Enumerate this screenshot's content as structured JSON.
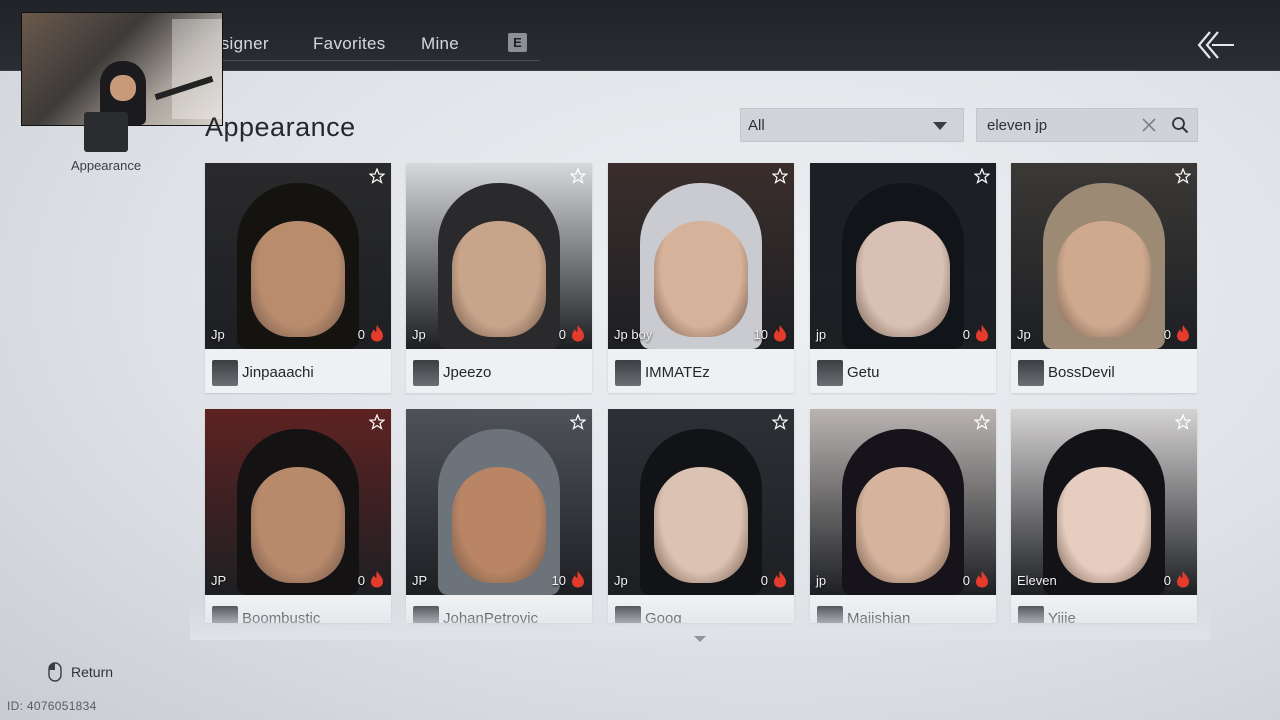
{
  "nav": {
    "tabs": [
      "esigner",
      "Favorites",
      "Mine"
    ],
    "hotkey": "E"
  },
  "sidebar": {
    "label": "Appearance"
  },
  "page": {
    "title": "Appearance"
  },
  "filter": {
    "selected": "All"
  },
  "search": {
    "value": "eleven jp"
  },
  "cards": [
    {
      "tag": "Jp",
      "likes": "0",
      "name": "Jinpaaachi",
      "hair": "#15130f",
      "skin": "#b98c6e",
      "bg": "#2a2a2c"
    },
    {
      "tag": "Jp",
      "likes": "0",
      "name": "Jpeezo",
      "hair": "#2a2a2d",
      "skin": "#c8a48a",
      "bg": "#d7d9dc"
    },
    {
      "tag": "Jp boy",
      "likes": "10",
      "name": "IMMATEz",
      "hair": "#c9cbd0",
      "skin": "#d7b29a",
      "bg": "#3b2e2c"
    },
    {
      "tag": "jp",
      "likes": "0",
      "name": "Getu",
      "hair": "#111418",
      "skin": "#d8c1b4",
      "bg": "#1c2026"
    },
    {
      "tag": "Jp",
      "likes": "0",
      "name": "BossDevil",
      "hair": "#9c8a74",
      "skin": "#cfa98e",
      "bg": "#3b3936"
    },
    {
      "tag": "JP",
      "likes": "0",
      "name": "Boombustic",
      "hair": "#141213",
      "skin": "#b88a6c",
      "bg": "#5e2222"
    },
    {
      "tag": "JP",
      "likes": "10",
      "name": "JohanPetrovic",
      "hair": "#6d737a",
      "skin": "#b98565",
      "bg": "#4f5359"
    },
    {
      "tag": "Jp",
      "likes": "0",
      "name": "Goog",
      "hair": "#121316",
      "skin": "#dcc2b2",
      "bg": "#2d3035"
    },
    {
      "tag": "jp",
      "likes": "0",
      "name": "Majishian",
      "hair": "#16141a",
      "skin": "#d6b39c",
      "bg": "#b9b4b2"
    },
    {
      "tag": "Eleven",
      "likes": "0",
      "name": "Yijie",
      "hair": "#121217",
      "skin": "#e6cdc0",
      "bg": "#d5d3d3"
    }
  ],
  "footer": {
    "return_label": "Return",
    "id_label": "ID: 4076051834"
  },
  "colors": {
    "flame": "#e53b2c",
    "star": "#ffffff"
  }
}
